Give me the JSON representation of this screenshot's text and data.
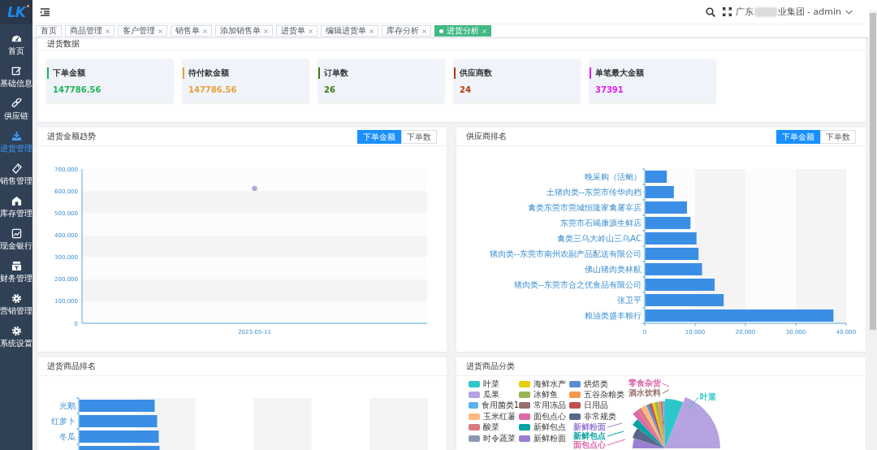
{
  "sidebar": {
    "logo": "LK",
    "items": [
      {
        "label": "首页",
        "selected": false
      },
      {
        "label": "基础信息",
        "selected": false
      },
      {
        "label": "供应链",
        "selected": false
      },
      {
        "label": "进货管理",
        "selected": true
      },
      {
        "label": "销售管理",
        "selected": false
      },
      {
        "label": "库存管理",
        "selected": false
      },
      {
        "label": "现金银行",
        "selected": false
      },
      {
        "label": "财务管理",
        "selected": false
      },
      {
        "label": "营销管理",
        "selected": false
      },
      {
        "label": "系统设置",
        "selected": false
      }
    ]
  },
  "header": {
    "company_prefix": "广东",
    "company_suffix": "业集团 - admin"
  },
  "tabs": [
    {
      "label": "首页",
      "closable": false,
      "selected": false
    },
    {
      "label": "商品管理",
      "closable": true,
      "selected": false
    },
    {
      "label": "客户管理",
      "closable": true,
      "selected": false
    },
    {
      "label": "销售单",
      "closable": true,
      "selected": false
    },
    {
      "label": "添加销售单",
      "closable": true,
      "selected": false
    },
    {
      "label": "进货单",
      "closable": true,
      "selected": false
    },
    {
      "label": "编辑进货单",
      "closable": true,
      "selected": false
    },
    {
      "label": "库存分析",
      "closable": true,
      "selected": false
    },
    {
      "label": "进货分析",
      "closable": true,
      "selected": true
    }
  ],
  "purchase_data": {
    "title": "进货数据",
    "cards": [
      {
        "label": "下单金额",
        "value": "147786.56",
        "color": "#1fb25a"
      },
      {
        "label": "待付款金额",
        "value": "147786.56",
        "color": "#e6a23c"
      },
      {
        "label": "订单数",
        "value": "26",
        "color": "#3d7a12"
      },
      {
        "label": "供应商数",
        "value": "24",
        "color": "#b4380f"
      },
      {
        "label": "单笔最大金额",
        "value": "37391",
        "color": "#e01ef5"
      }
    ]
  },
  "amount_trend": {
    "title": "进货金额趋势",
    "toggle": [
      {
        "label": "下单金额",
        "selected": true
      },
      {
        "label": "下单数",
        "selected": false
      }
    ],
    "chart_data": {
      "type": "line",
      "categories": [
        "2023-05-11"
      ],
      "series": [
        {
          "color": "#b6a2de",
          "marker": "circle",
          "values": [
            612000
          ]
        }
      ],
      "ylim": [
        0,
        700000
      ],
      "yticks": [
        {
          "value": 0,
          "label": "0"
        },
        {
          "value": 100000,
          "label": "100,000"
        },
        {
          "value": 200000,
          "label": "200,000"
        },
        {
          "value": 300000,
          "label": "300,000"
        },
        {
          "value": 400000,
          "label": "400,000"
        },
        {
          "value": 500000,
          "label": "500,000"
        },
        {
          "value": 600000,
          "label": "600,000"
        },
        {
          "value": 700000,
          "label": "700,000"
        }
      ]
    }
  },
  "supplier_ranking": {
    "title": "供应商排名",
    "toggle": [
      {
        "label": "下单金额",
        "selected": true
      },
      {
        "label": "下单数",
        "selected": false
      }
    ],
    "chart_data": {
      "type": "bar",
      "orientation": "horizontal",
      "categories": [
        "晚采购（活鲍）",
        "土猪肉类--东莞市传华肉档",
        "禽类东莞市莞城恒隆家禽屠宰店",
        "东莞市石竭康源生鲜店",
        "禽类三乌大岭山三乌AC",
        "猪肉类--东莞市南州农副产品配送有限公司",
        "佛山猪肉类林航",
        "猪肉类--东莞市合之优食品有限公司",
        "张卫平",
        "粮油类盛丰粮行"
      ],
      "series": [
        {
          "color": "#3a8ee6",
          "values": [
            4300,
            5700,
            8300,
            9000,
            10200,
            10600,
            11300,
            13800,
            15600,
            37400
          ]
        }
      ],
      "xlim": [
        0,
        40000
      ],
      "xticks": [
        {
          "value": 0,
          "label": "0"
        },
        {
          "value": 10000,
          "label": "10,000"
        },
        {
          "value": 20000,
          "label": "20,000"
        },
        {
          "value": 30000,
          "label": "30,000"
        },
        {
          "value": 40000,
          "label": "40,000"
        }
      ]
    }
  },
  "product_ranking": {
    "title": "进货商品排名",
    "labels": [
      "光鹅",
      "红萝卜",
      "冬瓜"
    ]
  },
  "product_category": {
    "title": "进货商品分类",
    "legend": [
      {
        "label": "叶菜",
        "color": "#2ec7c9"
      },
      {
        "label": "瓜果",
        "color": "#b6a2de"
      },
      {
        "label": "食用菌类1",
        "color": "#5ab1ef"
      },
      {
        "label": "玉米红薯",
        "color": "#ffb980"
      },
      {
        "label": "酸菜",
        "color": "#d87a80"
      },
      {
        "label": "时令蔬菜",
        "color": "#8d98b3"
      },
      {
        "label": "海鲜水产",
        "color": "#e5cf0d"
      },
      {
        "label": "冰鲜鱼",
        "color": "#97b552"
      },
      {
        "label": "常用冻品",
        "color": "#95706d"
      },
      {
        "label": "面包点心",
        "color": "#dc69aa"
      },
      {
        "label": "新鲜包点",
        "color": "#07a2a4"
      },
      {
        "label": "新鲜粉面",
        "color": "#9a7fd1"
      },
      {
        "label": "烘焙类",
        "color": "#588dd5"
      },
      {
        "label": "五谷杂粮类",
        "color": "#f5994e"
      },
      {
        "label": "日用品",
        "color": "#c05050"
      },
      {
        "label": "非常规类",
        "color": "#59678c"
      }
    ],
    "slice_labels": [
      {
        "label": "零食杂货",
        "color": "#dc69aa"
      },
      {
        "label": "酒水饮料",
        "color": "#95706d"
      },
      {
        "label": "叶菜",
        "color": "#2ec7c9"
      },
      {
        "label": "新鲜粉面",
        "color": "#9a7fd1"
      },
      {
        "label": "新鲜包点",
        "color": "#07a2a4"
      },
      {
        "label": "面包点心",
        "color": "#dc69aa"
      }
    ]
  }
}
